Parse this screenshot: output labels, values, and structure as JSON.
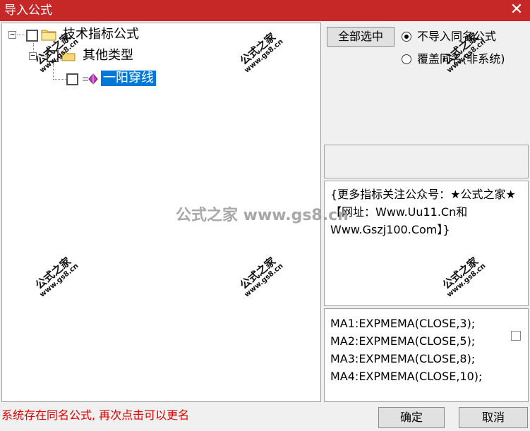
{
  "window": {
    "title": "导入公式",
    "close_glyph": "✕",
    "close_icon": "close-icon"
  },
  "tree": {
    "root": {
      "expander": "−",
      "icon": "folder-icon",
      "label": "技术指标公式",
      "checked": false
    },
    "child": {
      "expander": "−",
      "icon": "folder-icon",
      "label": "其他类型",
      "checked": false
    },
    "leaf": {
      "icon": "formula-icon",
      "label": "一阳穿线",
      "checked": false,
      "selected": true
    }
  },
  "options": {
    "select_all_label": "全部选中",
    "radio_group": [
      {
        "label": "不导入同名公式",
        "checked": true
      },
      {
        "label": "覆盖同名(非系统)",
        "checked": false
      }
    ]
  },
  "description": {
    "text": "{更多指标关注公众号：★公式之家★ 【网址：Www.Uu11.Cn和Www.Gszj100.Com】}"
  },
  "code": {
    "lines": [
      "MA1:EXPMEMA(CLOSE,3);",
      "MA2:EXPMEMA(CLOSE,5);",
      "MA3:EXPMEMA(CLOSE,8);",
      "MA4:EXPMEMA(CLOSE,10);"
    ]
  },
  "status": {
    "message": "系统存在同名公式, 再次点击可以更名"
  },
  "footer": {
    "ok_label": "确定",
    "cancel_label": "取消"
  },
  "watermarks": {
    "stamp_cn": "公式之家",
    "stamp_url": "www.gs8.cn",
    "center_text": "公式之家 www.gs8.cn"
  },
  "colors": {
    "titlebar": "#c62828",
    "selection": "#0078d7",
    "status_text": "#e00000"
  }
}
